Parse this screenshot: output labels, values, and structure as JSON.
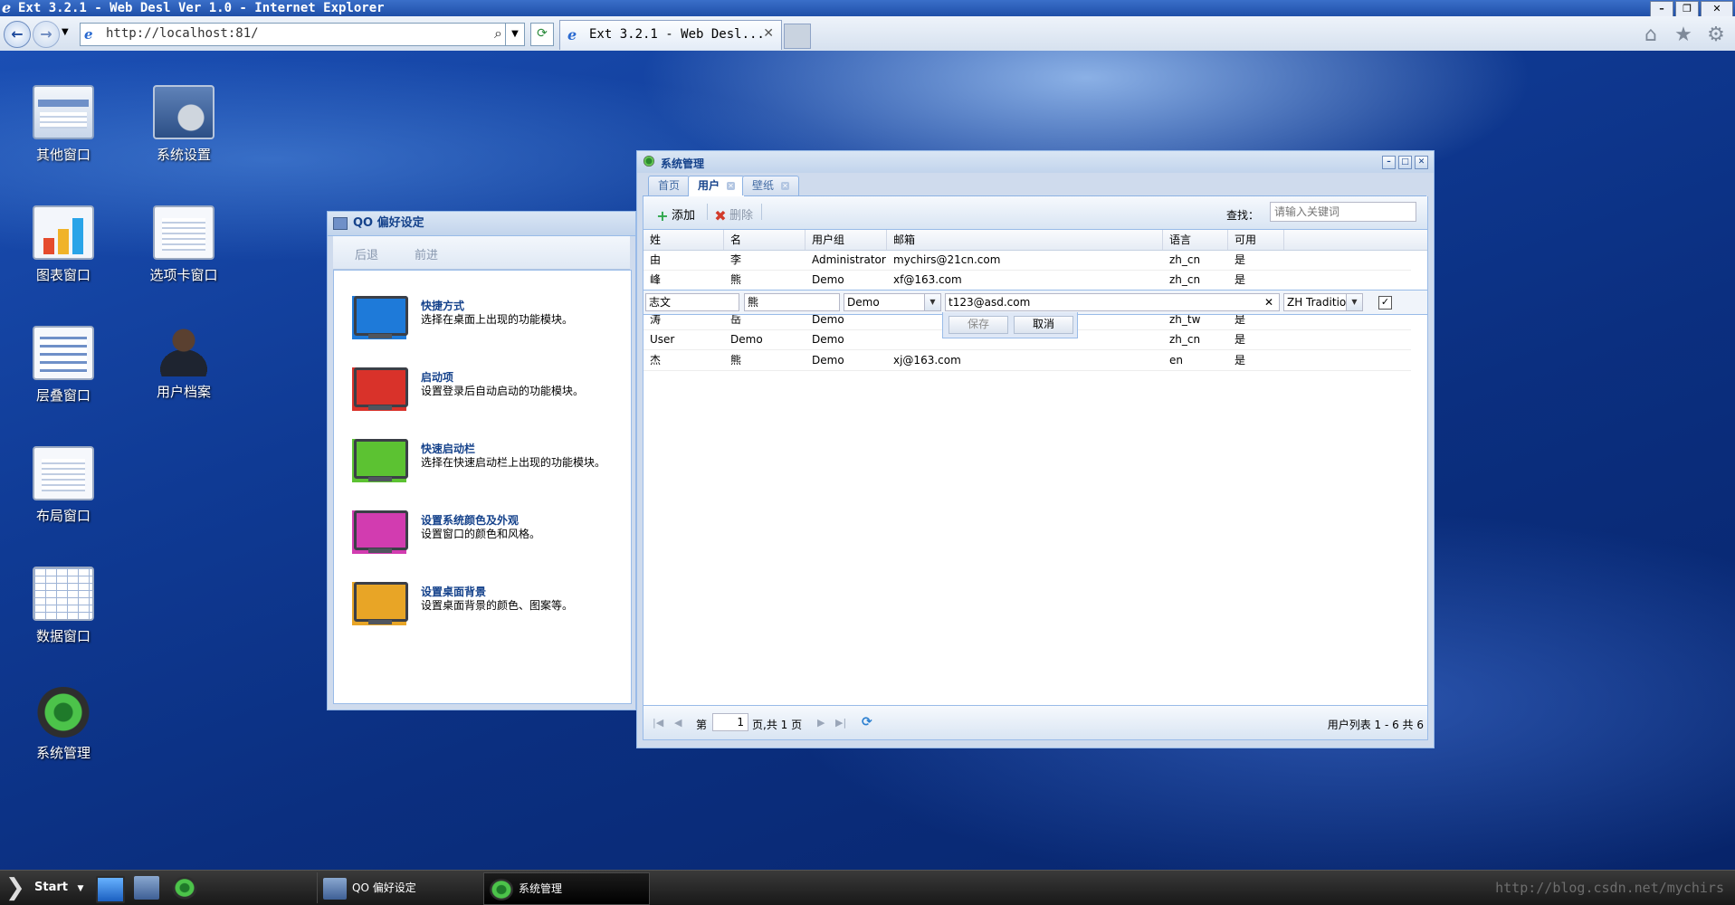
{
  "browser": {
    "window_title": "Ext 3.2.1 - Web Desl Ver 1.0 - Internet Explorer",
    "url": "http://localhost:81/",
    "tab_title": "Ext 3.2.1 - Web Desl...",
    "minimize_glyph": "–",
    "restore_glyph": "❐",
    "close_glyph": "✕"
  },
  "desktop": {
    "icons": [
      {
        "label": "其他窗口",
        "icon": "window-icon"
      },
      {
        "label": "系统设置",
        "icon": "settings-icon"
      },
      {
        "label": "图表窗口",
        "icon": "chart-icon"
      },
      {
        "label": "选项卡窗口",
        "icon": "tabs-icon"
      },
      {
        "label": "层叠窗口",
        "icon": "cascade-icon"
      },
      {
        "label": "用户档案",
        "icon": "user-icon"
      },
      {
        "label": "布局窗口",
        "icon": "layout-icon"
      },
      {
        "label": "数据窗口",
        "icon": "grid-icon"
      },
      {
        "label": "系统管理",
        "icon": "system-icon"
      }
    ]
  },
  "qo_window": {
    "title": "QO 偏好设定",
    "back": "后退",
    "forward": "前进",
    "items": [
      {
        "title": "快捷方式",
        "desc": "选择在桌面上出现的功能模块。",
        "color": "#1e7ad9"
      },
      {
        "title": "启动项",
        "desc": "设置登录后自动启动的功能模块。",
        "color": "#d9322a"
      },
      {
        "title": "快速启动栏",
        "desc": "选择在快速启动栏上出现的功能模块。",
        "color": "#5cc232"
      },
      {
        "title": "设置系统颜色及外观",
        "desc": "设置窗口的颜色和风格。",
        "color": "#d23cb0"
      },
      {
        "title": "设置桌面背景",
        "desc": "设置桌面背景的颜色、图案等。",
        "color": "#e8a526"
      }
    ]
  },
  "sys_window": {
    "title": "系统管理",
    "tabs": [
      {
        "label": "首页",
        "closable": false
      },
      {
        "label": "用户",
        "closable": true,
        "active": true
      },
      {
        "label": "壁纸",
        "closable": true
      }
    ],
    "toolbar": {
      "add_label": "添加",
      "delete_label": "删除",
      "search_label": "查找：",
      "search_placeholder": "请输入关键词"
    },
    "columns": [
      "姓",
      "名",
      "用户组",
      "邮箱",
      "语言",
      "可用"
    ],
    "rows": [
      [
        "由",
        "李",
        "Administrator",
        "mychirs@21cn.com",
        "zh_cn",
        "是"
      ],
      [
        "峰",
        "熊",
        "Demo",
        "xf@163.com",
        "zh_cn",
        "是"
      ],
      [
        "涛",
        "岳",
        "Demo",
        "",
        "zh_tw",
        "是"
      ],
      [
        "User",
        "Demo",
        "Demo",
        "",
        "zh_cn",
        "是"
      ],
      [
        "杰",
        "熊",
        "Demo",
        "xj@163.com",
        "en",
        "是"
      ]
    ],
    "editor": {
      "first_name": "志文",
      "last_name": "熊",
      "group": "Demo",
      "email": "t123@asd.com",
      "language": "ZH Traditio",
      "enabled_mark": "✓",
      "save_label": "保存",
      "cancel_label": "取消"
    },
    "pager": {
      "page_prefix": "第",
      "page_value": "1",
      "page_suffix": "页,共 1 页",
      "info": "用户列表 1 - 6 共 6"
    }
  },
  "taskbar": {
    "start_label": "Start",
    "tasks": [
      {
        "label": "QO 偏好设定"
      },
      {
        "label": "系统管理"
      }
    ],
    "watermark": "http://blog.csdn.net/mychirs"
  }
}
